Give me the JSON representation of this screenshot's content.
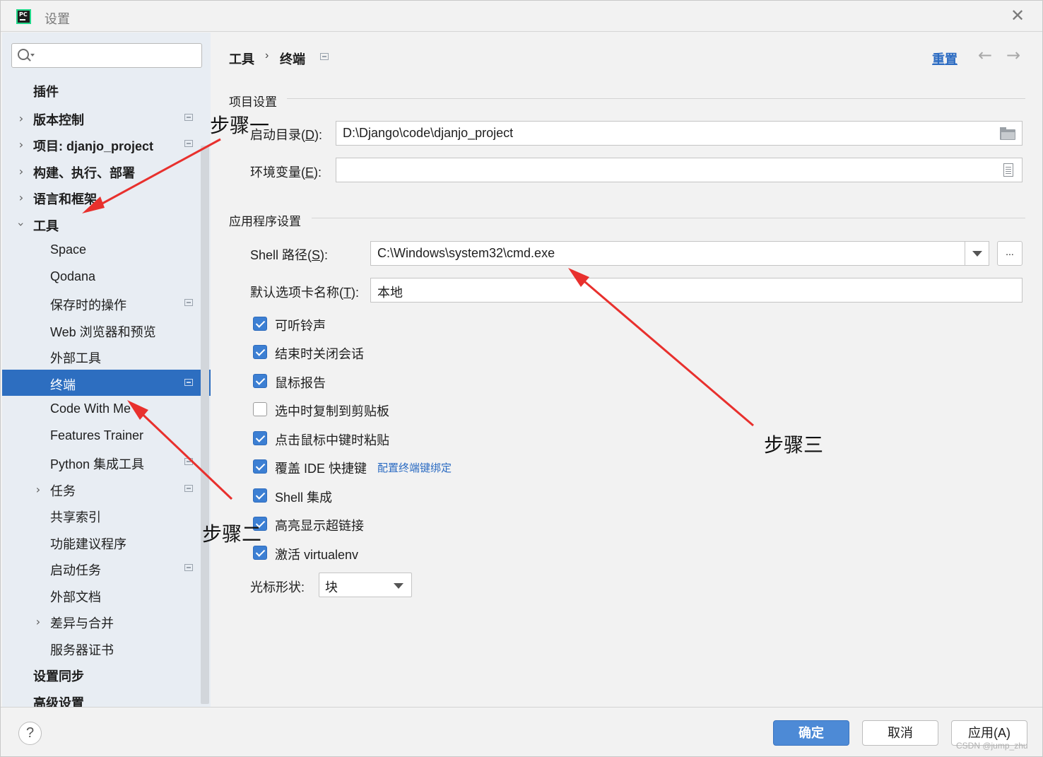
{
  "window": {
    "title": "设置",
    "app_icon_text": "PC"
  },
  "sidebar": {
    "search_placeholder": "",
    "items": [
      {
        "label": "插件",
        "bold": true
      },
      {
        "label": "版本控制",
        "bold": true
      },
      {
        "label": "项目: djanjo_project",
        "bold": true
      },
      {
        "label": "构建、执行、部署",
        "bold": true
      },
      {
        "label": "语言和框架",
        "bold": true
      },
      {
        "label": "工具",
        "bold": true
      },
      {
        "label": "Space"
      },
      {
        "label": "Qodana"
      },
      {
        "label": "保存时的操作"
      },
      {
        "label": "Web 浏览器和预览"
      },
      {
        "label": "外部工具"
      },
      {
        "label": "终端"
      },
      {
        "label": "Code With Me"
      },
      {
        "label": "Features Trainer"
      },
      {
        "label": "Python 集成工具"
      },
      {
        "label": "任务"
      },
      {
        "label": "共享索引"
      },
      {
        "label": "功能建议程序"
      },
      {
        "label": "启动任务"
      },
      {
        "label": "外部文档"
      },
      {
        "label": "差异与合并"
      },
      {
        "label": "服务器证书"
      },
      {
        "label": "设置同步",
        "bold": true
      },
      {
        "label": "高级设置",
        "bold": true
      }
    ]
  },
  "header": {
    "crumb_parent": "工具",
    "crumb_sep": "›",
    "crumb_current": "终端",
    "reset_label": "重置",
    "back_arrow": "←",
    "forward_arrow": "→"
  },
  "project_settings": {
    "section_title": "项目设置",
    "start_dir_label": "启动目录(",
    "start_dir_mnemonic": "D",
    "start_dir_label_end": "):",
    "start_dir_value": "D:\\Django\\code\\djanjo_project",
    "env_label": "环境变量(",
    "env_mnemonic": "E",
    "env_label_end": "):",
    "env_value": ""
  },
  "app_settings": {
    "section_title": "应用程序设置",
    "shell_label": "Shell 路径(",
    "shell_mnemonic": "S",
    "shell_label_end": "):",
    "shell_value": "C:\\Windows\\system32\\cmd.exe",
    "browse_label": "...",
    "tab_name_label": "默认选项卡名称(",
    "tab_name_mnemonic": "T",
    "tab_name_label_end": "):",
    "tab_name_value": "本地",
    "checkboxes": [
      {
        "label": "可听铃声",
        "checked": true
      },
      {
        "label": "结束时关闭会话",
        "checked": true
      },
      {
        "label": "鼠标报告",
        "checked": true
      },
      {
        "label": "选中时复制到剪贴板",
        "checked": false
      },
      {
        "label": "点击鼠标中键时粘贴",
        "checked": true
      },
      {
        "label": "覆盖 IDE 快捷键",
        "checked": true,
        "link": "配置终端键绑定"
      },
      {
        "label": "Shell 集成",
        "checked": true
      },
      {
        "label": "高亮显示超链接",
        "checked": true
      },
      {
        "label": "激活 virtualenv",
        "checked": true
      }
    ],
    "cursor_shape_label": "光标形状:",
    "cursor_shape_value": "块"
  },
  "footer": {
    "help_label": "?",
    "ok_label": "确定",
    "cancel_label": "取消",
    "apply_label": "应用(A)",
    "watermark": "CSDN @jump_zhu"
  },
  "annotations": {
    "step1": "步骤一",
    "step2": "步骤二",
    "step3": "步骤三",
    "arrow_color": "#e8302d"
  }
}
